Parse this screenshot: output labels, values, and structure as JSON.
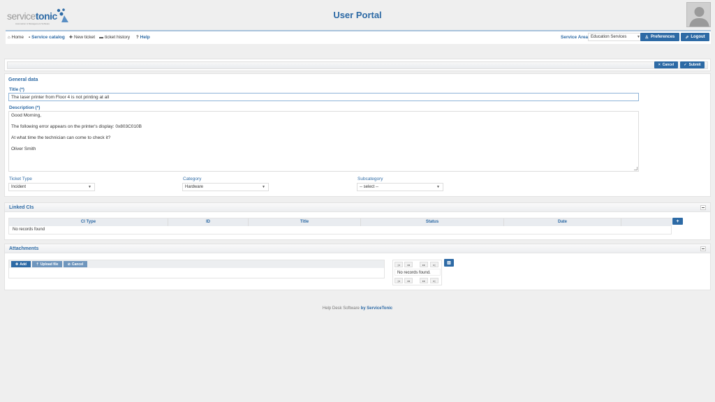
{
  "header": {
    "logo_part1": "service",
    "logo_part2": "tonic",
    "logo_tagline": "Automation & Management Software",
    "title": "User Portal"
  },
  "nav": {
    "items": [
      {
        "label": "Home",
        "icon": "home-icon"
      },
      {
        "label": "Service catalog",
        "icon": "catalog-icon"
      },
      {
        "label": "New ticket",
        "icon": "plus-icon"
      },
      {
        "label": "ticket history",
        "icon": "history-icon"
      },
      {
        "label": "Help",
        "icon": "help-icon"
      }
    ],
    "service_area_label": "Service Area",
    "service_area_value": "Education Services",
    "preferences_label": "Preferences",
    "logout_label": "Logout"
  },
  "actions": {
    "cancel_label": "Cancel",
    "submit_label": "Submit"
  },
  "general": {
    "section_title": "General data",
    "title_label": "Title (*)",
    "title_value": "The laser printer from Floor 4 is not printing at all",
    "description_label": "Description (*)",
    "description_lines": [
      "Good Morning,",
      "The following error appears on the printer's display: 0x803C010B",
      "At what time the technician can come to check it?",
      "Oliver Smith"
    ],
    "ticket_type_label": "Ticket Type",
    "ticket_type_value": "Incident",
    "category_label": "Category",
    "category_value": "Hardware",
    "subcategory_label": "Subcategory",
    "subcategory_value": "-- select --"
  },
  "linked_cis": {
    "section_title": "Linked CIs",
    "columns": [
      "CI Type",
      "ID",
      "Title",
      "Status",
      "Date",
      ""
    ],
    "empty_text": "No records found"
  },
  "attachments": {
    "section_title": "Attachments",
    "add_label": "Add",
    "upload_label": "Upload file",
    "cancel_label": "Cancel",
    "empty_text": "No records found.",
    "pager": [
      "|◂",
      "◂◂",
      "▸▸",
      "▸|"
    ]
  },
  "footer": {
    "text": "Help Desk Software ",
    "brand": "by ServiceTonic"
  },
  "colors": {
    "accent": "#2d6aa5",
    "background": "#efefef"
  }
}
